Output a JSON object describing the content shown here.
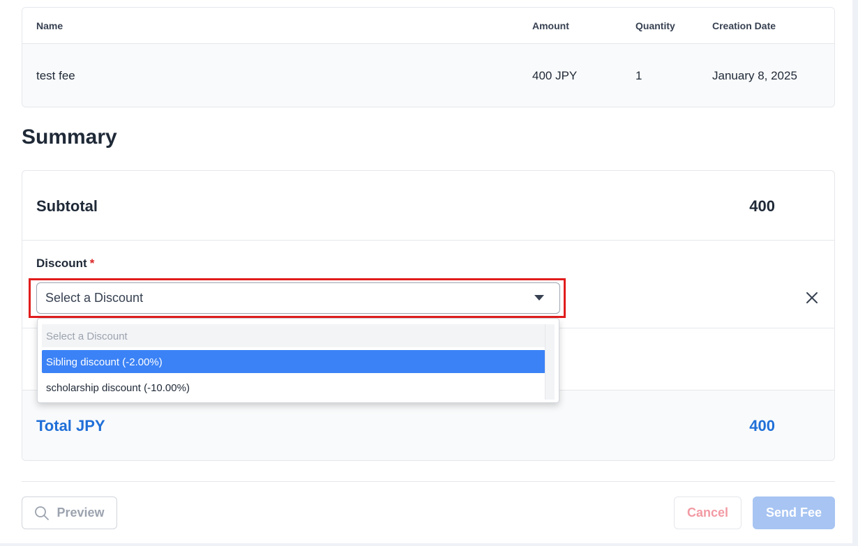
{
  "fee_table": {
    "headers": {
      "name": "Name",
      "amount": "Amount",
      "quantity": "Quantity",
      "creation_date": "Creation Date"
    },
    "rows": [
      {
        "name": "test fee",
        "amount": "400 JPY",
        "quantity": "1",
        "creation_date": "January 8, 2025"
      }
    ]
  },
  "summary": {
    "title": "Summary",
    "subtotal_label": "Subtotal",
    "subtotal_value": "400",
    "discount_label": "Discount",
    "required_marker": "*",
    "total_label": "Total JPY",
    "total_value": "400"
  },
  "discount_select": {
    "value": "Select a Discount",
    "options": [
      "Select a Discount",
      "Sibling discount (-2.00%)",
      "scholarship discount (-10.00%)"
    ],
    "highlighted_option": "Sibling discount (-2.00%)"
  },
  "actions": {
    "preview": "Preview",
    "cancel": "Cancel",
    "send_fee": "Send Fee"
  },
  "colors": {
    "accent_blue": "#1f6fd8",
    "option_highlight": "#3b82f6",
    "required_red": "#dc2626",
    "focus_outline": "#e11d1d",
    "send_button_disabled": "#a7c4f2",
    "cancel_text": "#f29aa3"
  },
  "icons": {
    "preview": "search-icon",
    "select_caret": "caret-down-icon",
    "remove_discount": "close-icon"
  }
}
